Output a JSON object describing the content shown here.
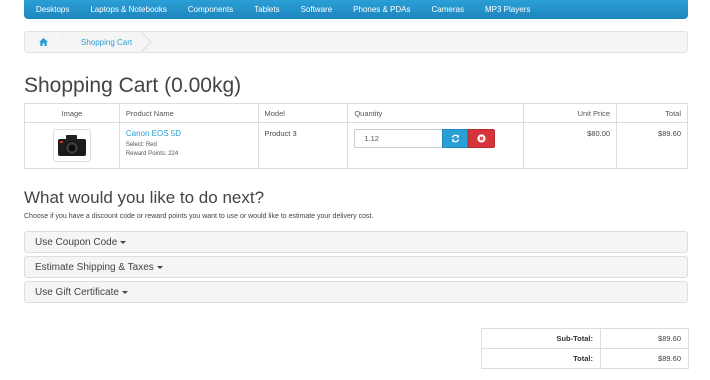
{
  "menu": [
    "Desktops",
    "Laptops & Notebooks",
    "Components",
    "Tablets",
    "Software",
    "Phones & PDAs",
    "Cameras",
    "MP3 Players"
  ],
  "breadcrumb": {
    "home_icon": "home-icon",
    "current": "Shopping Cart"
  },
  "page_title": "Shopping Cart  (0.00kg)",
  "cart": {
    "headers": {
      "image": "Image",
      "name": "Product Name",
      "model": "Model",
      "quantity": "Quantity",
      "unit_price": "Unit Price",
      "total": "Total"
    },
    "items": [
      {
        "thumb_icon": "camera-icon",
        "name": "Canon EOS 5D",
        "option": "Select: Red",
        "reward": "Reward Points: 224",
        "model": "Product 3",
        "quantity": "1.12",
        "update_icon": "refresh-icon",
        "remove_icon": "remove-icon",
        "unit_price": "$80.00",
        "total": "$89.60"
      }
    ]
  },
  "next": {
    "title": "What would you like to do next?",
    "intro": "Choose if you have a discount code or reward points you want to use or would like to estimate your delivery cost.",
    "panels": [
      "Use Coupon Code",
      "Estimate Shipping & Taxes",
      "Use Gift Certificate"
    ]
  },
  "totals": [
    {
      "label": "Sub-Total:",
      "value": "$89.60"
    },
    {
      "label": "Total:",
      "value": "$89.60"
    }
  ],
  "colors": {
    "accent": "#2a9fd6",
    "danger": "#d6343b"
  }
}
